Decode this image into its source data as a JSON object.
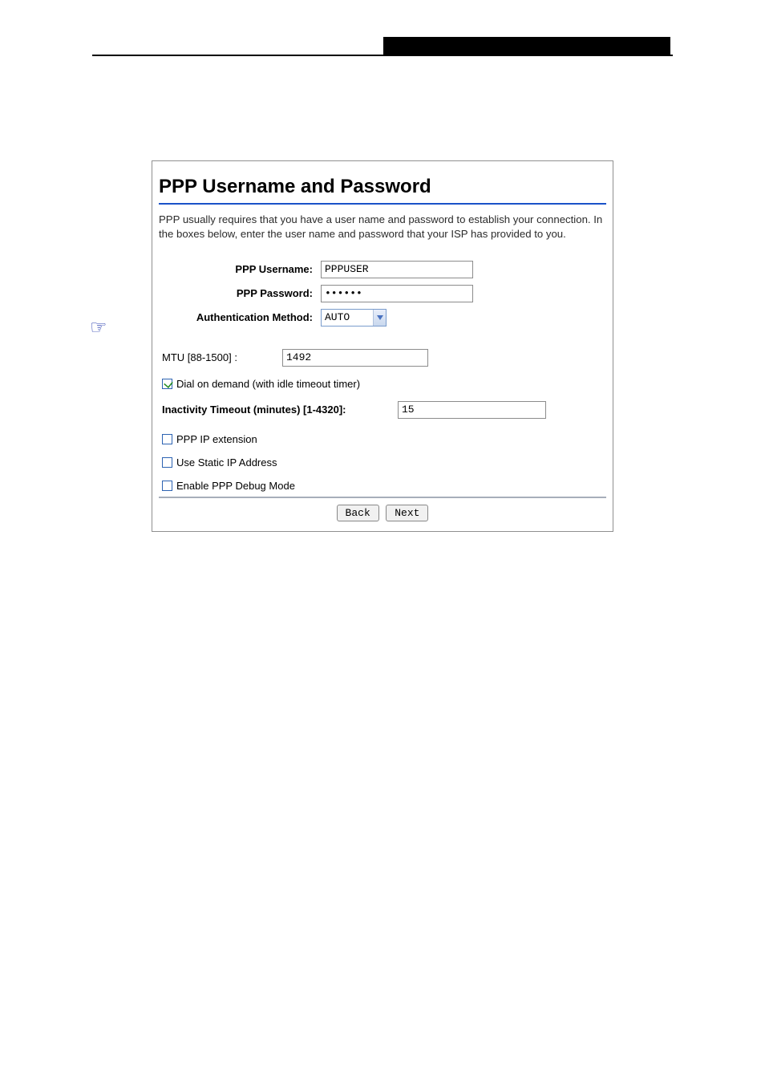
{
  "title": "PPP Username and Password",
  "description": "PPP usually requires that you have a user name and password to establish your connection. In the boxes below, enter the user name and password that your ISP has provided to you.",
  "form": {
    "username_label": "PPP Username:",
    "username_value": "PPPUSER",
    "password_label": "PPP Password:",
    "password_value": "••••••",
    "auth_label": "Authentication Method:",
    "auth_value": "AUTO",
    "mtu_label": "MTU [88-1500] :",
    "mtu_value": "1492",
    "dial_on_demand_label": "Dial on demand (with idle timeout timer)",
    "dial_on_demand_checked": true,
    "inactivity_label": "Inactivity Timeout (minutes) [1-4320]:",
    "inactivity_value": "15",
    "ppp_ip_ext_label": "PPP IP extension",
    "ppp_ip_ext_checked": false,
    "static_ip_label": "Use Static IP Address",
    "static_ip_checked": false,
    "debug_label": "Enable PPP Debug Mode",
    "debug_checked": false
  },
  "buttons": {
    "back": "Back",
    "next": "Next"
  }
}
